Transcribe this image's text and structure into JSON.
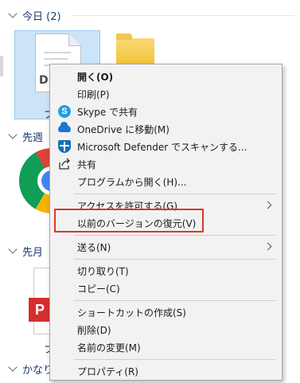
{
  "explorer": {
    "groups": [
      {
        "label": "今日 (2)"
      },
      {
        "label": "先週"
      },
      {
        "label": "先月"
      },
      {
        "label": "かなり"
      }
    ],
    "files": {
      "selected_doc_code": "D",
      "selected_doc_caption": "フ",
      "pdf_badge": "P",
      "pdf_caption": "フ"
    }
  },
  "context_menu": {
    "items": [
      {
        "label": "開く(O)",
        "icon": "",
        "bold": true,
        "submenu": false
      },
      {
        "label": "印刷(P)",
        "icon": "",
        "bold": false,
        "submenu": false
      },
      {
        "label": "Skype で共有",
        "icon": "skype-icon",
        "bold": false,
        "submenu": false
      },
      {
        "label": "OneDrive に移動(M)",
        "icon": "onedrive-cloud-icon",
        "bold": false,
        "submenu": false
      },
      {
        "label": "Microsoft Defender でスキャンする...",
        "icon": "defender-shield-icon",
        "bold": false,
        "submenu": false
      },
      {
        "label": "共有",
        "icon": "share-icon",
        "bold": false,
        "submenu": false
      },
      {
        "label": "プログラムから開く(H)...",
        "icon": "",
        "bold": false,
        "submenu": false
      },
      {
        "label": "アクセスを許可する(G)",
        "icon": "",
        "bold": false,
        "submenu": true
      },
      {
        "label": "以前のバージョンの復元(V)",
        "icon": "",
        "bold": false,
        "submenu": false,
        "highlighted": true
      },
      {
        "label": "送る(N)",
        "icon": "",
        "bold": false,
        "submenu": true
      },
      {
        "label": "切り取り(T)",
        "icon": "",
        "bold": false,
        "submenu": false
      },
      {
        "label": "コピー(C)",
        "icon": "",
        "bold": false,
        "submenu": false
      },
      {
        "label": "ショートカットの作成(S)",
        "icon": "",
        "bold": false,
        "submenu": false
      },
      {
        "label": "削除(D)",
        "icon": "",
        "bold": false,
        "submenu": false
      },
      {
        "label": "名前の変更(M)",
        "icon": "",
        "bold": false,
        "submenu": false
      },
      {
        "label": "プロパティ(R)",
        "icon": "",
        "bold": false,
        "submenu": false
      }
    ],
    "highlight_color": "#d9362b"
  },
  "icons": {
    "skype_glyph": "S"
  }
}
